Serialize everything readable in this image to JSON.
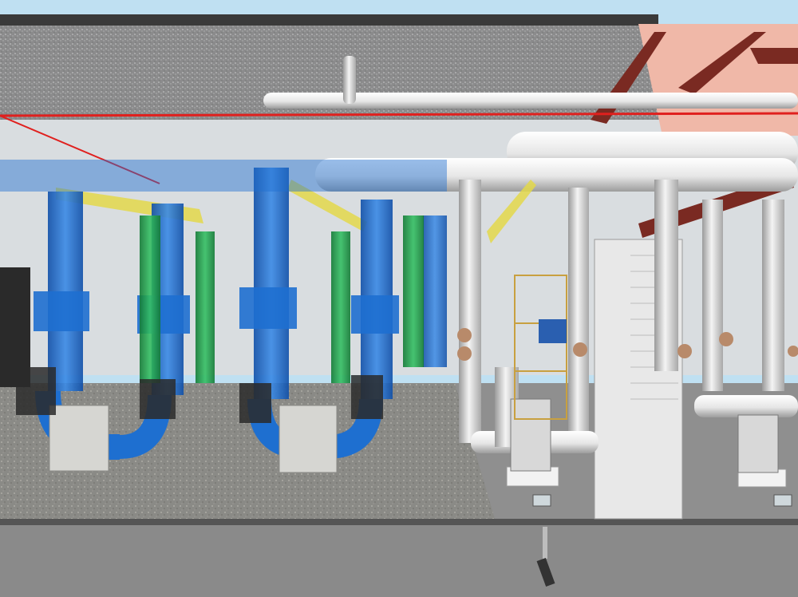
{
  "scene": {
    "kind": "bim-pipe-model-over-point-cloud",
    "regions": {
      "left": "point-cloud-scan",
      "right": "modeled-geometry"
    },
    "colors": {
      "sky": "#bfe0f2",
      "slab": "#8a8a8a",
      "slab_dark": "#555555",
      "floor": "#9a9a9a",
      "floor_model": "#8f8f8f",
      "blue_pipe": "#1e6fd0",
      "green_pipe": "#1f9a46",
      "white_pipe": "#f2f2f2",
      "sprinkler_red": "#e0201e",
      "steel_beam": "#7a2a22",
      "yellow_beam": "#e3d84a",
      "valve_bronze": "#b88a6a"
    },
    "elements": [
      {
        "name": "blue-supply-pipe",
        "color": "blue_pipe",
        "count": 4
      },
      {
        "name": "green-return-pipe",
        "color": "green_pipe",
        "count": 4
      },
      {
        "name": "modeled-white-pipe",
        "color": "white_pipe",
        "count": 6
      },
      {
        "name": "pump-base",
        "count": 2
      },
      {
        "name": "sprinkler-line",
        "color": "sprinkler_red",
        "count": 1
      },
      {
        "name": "steel-beam",
        "color": "steel_beam",
        "count": 3
      },
      {
        "name": "yellow-beam",
        "color": "yellow_beam",
        "count": 3
      }
    ]
  }
}
